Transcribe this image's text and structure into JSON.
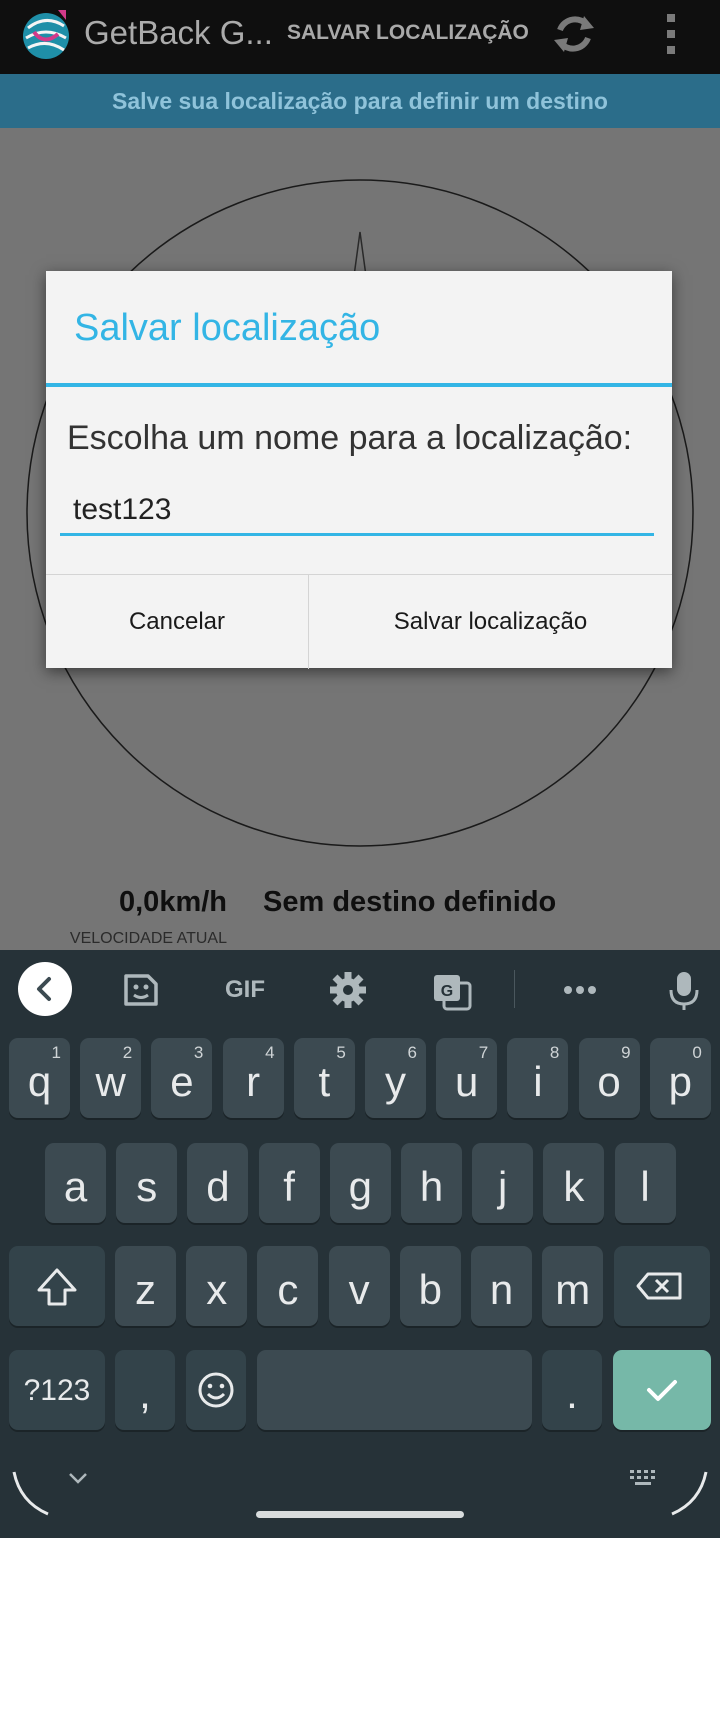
{
  "actionbar": {
    "app_title": "GetBack G...",
    "save_action": "SALVAR LOCALIZAÇÃO"
  },
  "banner": "Salve sua localização para definir um destino",
  "status": {
    "speed": "0,0km/h",
    "speed_label": "VELOCIDADE ATUAL",
    "destination": "Sem destino definido"
  },
  "dialog": {
    "title": "Salvar localização",
    "message": "Escolha um nome para a localização:",
    "input_value": "test123",
    "cancel_label": "Cancelar",
    "save_label": "Salvar localização"
  },
  "keyboard": {
    "toolbar": [
      "back-icon",
      "sticker-icon",
      "GIF",
      "gear-icon",
      "translate-icon",
      "more-icon",
      "mic-icon"
    ],
    "gif_label": "GIF",
    "row1": [
      {
        "k": "q",
        "h": "1"
      },
      {
        "k": "w",
        "h": "2"
      },
      {
        "k": "e",
        "h": "3"
      },
      {
        "k": "r",
        "h": "4"
      },
      {
        "k": "t",
        "h": "5"
      },
      {
        "k": "y",
        "h": "6"
      },
      {
        "k": "u",
        "h": "7"
      },
      {
        "k": "i",
        "h": "8"
      },
      {
        "k": "o",
        "h": "9"
      },
      {
        "k": "p",
        "h": "0"
      }
    ],
    "row2": [
      "a",
      "s",
      "d",
      "f",
      "g",
      "h",
      "j",
      "k",
      "l"
    ],
    "row3": [
      "z",
      "x",
      "c",
      "v",
      "b",
      "n",
      "m"
    ],
    "symbols_label": "?123",
    "comma_label": ",",
    "period_label": "."
  },
  "colors": {
    "accent": "#33b5e5",
    "actionbar": "#0f0f0f",
    "banner": "#2b6d8a",
    "keyboard_bg": "#263238",
    "key_bg": "#3c4a51",
    "enter_key": "#76b8a8"
  }
}
